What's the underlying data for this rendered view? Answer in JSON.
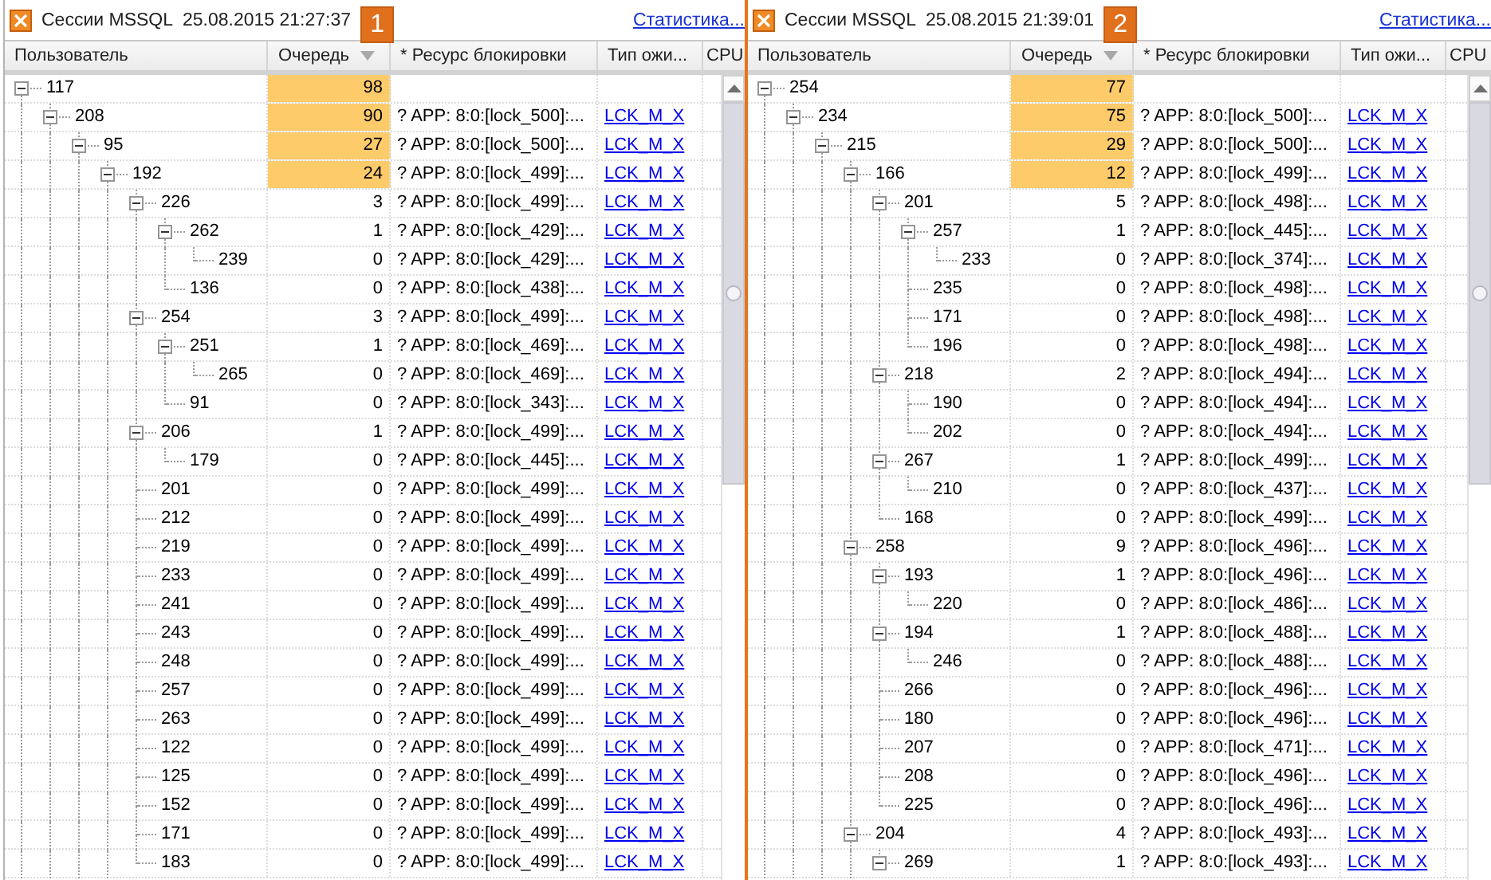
{
  "panels": [
    {
      "title": "Сессии MSSQL",
      "timestamp": "25.08.2015 21:27:37",
      "badge": "1",
      "stats_link": "Статистика...",
      "columns": [
        {
          "label": "Пользователь",
          "sorted": false
        },
        {
          "label": "Очередь",
          "sorted": true
        },
        {
          "label": "* Ресурс блокировки",
          "sorted": false
        },
        {
          "label": "Тип ожи...",
          "sorted": false
        },
        {
          "label": "CPU"
        }
      ],
      "rows": [
        {
          "user": "117",
          "queue": "98",
          "highlighted": true,
          "expanded": true,
          "children": [
            {
              "user": "208",
              "queue": "90",
              "highlighted": true,
              "resource": "? APP: 8:0:[lock_500]:...",
              "wait_type": "LCK_M_X",
              "expanded": true,
              "children": [
                {
                  "user": "95",
                  "queue": "27",
                  "highlighted": true,
                  "resource": "? APP: 8:0:[lock_500]:...",
                  "wait_type": "LCK_M_X",
                  "expanded": true,
                  "children": [
                    {
                      "user": "192",
                      "queue": "24",
                      "highlighted": true,
                      "resource": "? APP: 8:0:[lock_499]:...",
                      "wait_type": "LCK_M_X",
                      "expanded": true,
                      "children": [
                        {
                          "user": "226",
                          "queue": "3",
                          "highlighted": false,
                          "resource": "? APP: 8:0:[lock_499]:...",
                          "wait_type": "LCK_M_X",
                          "expanded": true,
                          "children": [
                            {
                              "user": "262",
                              "queue": "1",
                              "highlighted": false,
                              "resource": "? APP: 8:0:[lock_429]:...",
                              "wait_type": "LCK_M_X",
                              "expanded": true,
                              "children": [
                                {
                                  "user": "239",
                                  "queue": "0",
                                  "highlighted": false,
                                  "resource": "? APP: 8:0:[lock_429]:...",
                                  "wait_type": "LCK_M_X"
                                }
                              ]
                            },
                            {
                              "user": "136",
                              "queue": "0",
                              "highlighted": false,
                              "resource": "? APP: 8:0:[lock_438]:...",
                              "wait_type": "LCK_M_X"
                            }
                          ]
                        },
                        {
                          "user": "254",
                          "queue": "3",
                          "highlighted": false,
                          "resource": "? APP: 8:0:[lock_499]:...",
                          "wait_type": "LCK_M_X",
                          "expanded": true,
                          "children": [
                            {
                              "user": "251",
                              "queue": "1",
                              "highlighted": false,
                              "resource": "? APP: 8:0:[lock_469]:...",
                              "wait_type": "LCK_M_X",
                              "expanded": true,
                              "children": [
                                {
                                  "user": "265",
                                  "queue": "0",
                                  "highlighted": false,
                                  "resource": "? APP: 8:0:[lock_469]:...",
                                  "wait_type": "LCK_M_X"
                                }
                              ]
                            },
                            {
                              "user": "91",
                              "queue": "0",
                              "highlighted": false,
                              "resource": "? APP: 8:0:[lock_343]:...",
                              "wait_type": "LCK_M_X"
                            }
                          ]
                        },
                        {
                          "user": "206",
                          "queue": "1",
                          "highlighted": false,
                          "resource": "? APP: 8:0:[lock_499]:...",
                          "wait_type": "LCK_M_X",
                          "expanded": true,
                          "children": [
                            {
                              "user": "179",
                              "queue": "0",
                              "highlighted": false,
                              "resource": "? APP: 8:0:[lock_445]:...",
                              "wait_type": "LCK_M_X"
                            }
                          ]
                        },
                        {
                          "user": "201",
                          "queue": "0",
                          "highlighted": false,
                          "resource": "? APP: 8:0:[lock_499]:...",
                          "wait_type": "LCK_M_X"
                        },
                        {
                          "user": "212",
                          "queue": "0",
                          "highlighted": false,
                          "resource": "? APP: 8:0:[lock_499]:...",
                          "wait_type": "LCK_M_X"
                        },
                        {
                          "user": "219",
                          "queue": "0",
                          "highlighted": false,
                          "resource": "? APP: 8:0:[lock_499]:...",
                          "wait_type": "LCK_M_X"
                        },
                        {
                          "user": "233",
                          "queue": "0",
                          "highlighted": false,
                          "resource": "? APP: 8:0:[lock_499]:...",
                          "wait_type": "LCK_M_X"
                        },
                        {
                          "user": "241",
                          "queue": "0",
                          "highlighted": false,
                          "resource": "? APP: 8:0:[lock_499]:...",
                          "wait_type": "LCK_M_X"
                        },
                        {
                          "user": "243",
                          "queue": "0",
                          "highlighted": false,
                          "resource": "? APP: 8:0:[lock_499]:...",
                          "wait_type": "LCK_M_X"
                        },
                        {
                          "user": "248",
                          "queue": "0",
                          "highlighted": false,
                          "resource": "? APP: 8:0:[lock_499]:...",
                          "wait_type": "LCK_M_X"
                        },
                        {
                          "user": "257",
                          "queue": "0",
                          "highlighted": false,
                          "resource": "? APP: 8:0:[lock_499]:...",
                          "wait_type": "LCK_M_X"
                        },
                        {
                          "user": "263",
                          "queue": "0",
                          "highlighted": false,
                          "resource": "? APP: 8:0:[lock_499]:...",
                          "wait_type": "LCK_M_X"
                        },
                        {
                          "user": "122",
                          "queue": "0",
                          "highlighted": false,
                          "resource": "? APP: 8:0:[lock_499]:...",
                          "wait_type": "LCK_M_X"
                        },
                        {
                          "user": "125",
                          "queue": "0",
                          "highlighted": false,
                          "resource": "? APP: 8:0:[lock_499]:...",
                          "wait_type": "LCK_M_X"
                        },
                        {
                          "user": "152",
                          "queue": "0",
                          "highlighted": false,
                          "resource": "? APP: 8:0:[lock_499]:...",
                          "wait_type": "LCK_M_X"
                        },
                        {
                          "user": "171",
                          "queue": "0",
                          "highlighted": false,
                          "resource": "? APP: 8:0:[lock_499]:...",
                          "wait_type": "LCK_M_X"
                        },
                        {
                          "user": "183",
                          "queue": "0",
                          "highlighted": false,
                          "resource": "? APP: 8:0:[lock_499]:...",
                          "wait_type": "LCK_M_X"
                        }
                      ]
                    }
                  ]
                }
              ]
            }
          ]
        }
      ]
    },
    {
      "title": "Сессии MSSQL",
      "timestamp": "25.08.2015 21:39:01",
      "badge": "2",
      "stats_link": "Статистика...",
      "columns": [
        {
          "label": "Пользователь",
          "sorted": false
        },
        {
          "label": "Очередь",
          "sorted": true
        },
        {
          "label": "* Ресурс блокировки",
          "sorted": false
        },
        {
          "label": "Тип ожи...",
          "sorted": false
        },
        {
          "label": "CPU"
        }
      ],
      "rows": [
        {
          "user": "254",
          "queue": "77",
          "highlighted": true,
          "expanded": true,
          "children": [
            {
              "user": "234",
              "queue": "75",
              "highlighted": true,
              "resource": "? APP: 8:0:[lock_500]:...",
              "wait_type": "LCK_M_X",
              "expanded": true,
              "children": [
                {
                  "user": "215",
                  "queue": "29",
                  "highlighted": true,
                  "resource": "? APP: 8:0:[lock_500]:...",
                  "wait_type": "LCK_M_X",
                  "expanded": true,
                  "children": [
                    {
                      "user": "166",
                      "queue": "12",
                      "highlighted": true,
                      "resource": "? APP: 8:0:[lock_499]:...",
                      "wait_type": "LCK_M_X",
                      "expanded": true,
                      "children": [
                        {
                          "user": "201",
                          "queue": "5",
                          "highlighted": false,
                          "resource": "? APP: 8:0:[lock_498]:...",
                          "wait_type": "LCK_M_X",
                          "expanded": true,
                          "children": [
                            {
                              "user": "257",
                              "queue": "1",
                              "highlighted": false,
                              "resource": "? APP: 8:0:[lock_445]:...",
                              "wait_type": "LCK_M_X",
                              "expanded": true,
                              "children": [
                                {
                                  "user": "233",
                                  "queue": "0",
                                  "highlighted": false,
                                  "resource": "? APP: 8:0:[lock_374]:...",
                                  "wait_type": "LCK_M_X"
                                }
                              ]
                            },
                            {
                              "user": "235",
                              "queue": "0",
                              "highlighted": false,
                              "resource": "? APP: 8:0:[lock_498]:...",
                              "wait_type": "LCK_M_X"
                            },
                            {
                              "user": "171",
                              "queue": "0",
                              "highlighted": false,
                              "resource": "? APP: 8:0:[lock_498]:...",
                              "wait_type": "LCK_M_X"
                            },
                            {
                              "user": "196",
                              "queue": "0",
                              "highlighted": false,
                              "resource": "? APP: 8:0:[lock_498]:...",
                              "wait_type": "LCK_M_X"
                            }
                          ]
                        },
                        {
                          "user": "218",
                          "queue": "2",
                          "highlighted": false,
                          "resource": "? APP: 8:0:[lock_494]:...",
                          "wait_type": "LCK_M_X",
                          "expanded": true,
                          "children": [
                            {
                              "user": "190",
                              "queue": "0",
                              "highlighted": false,
                              "resource": "? APP: 8:0:[lock_494]:...",
                              "wait_type": "LCK_M_X"
                            },
                            {
                              "user": "202",
                              "queue": "0",
                              "highlighted": false,
                              "resource": "? APP: 8:0:[lock_494]:...",
                              "wait_type": "LCK_M_X"
                            }
                          ]
                        },
                        {
                          "user": "267",
                          "queue": "1",
                          "highlighted": false,
                          "resource": "? APP: 8:0:[lock_499]:...",
                          "wait_type": "LCK_M_X",
                          "expanded": true,
                          "children": [
                            {
                              "user": "210",
                              "queue": "0",
                              "highlighted": false,
                              "resource": "? APP: 8:0:[lock_437]:...",
                              "wait_type": "LCK_M_X"
                            }
                          ]
                        },
                        {
                          "user": "168",
                          "queue": "0",
                          "highlighted": false,
                          "resource": "? APP: 8:0:[lock_499]:...",
                          "wait_type": "LCK_M_X"
                        }
                      ]
                    },
                    {
                      "user": "258",
                      "queue": "9",
                      "highlighted": false,
                      "resource": "? APP: 8:0:[lock_496]:...",
                      "wait_type": "LCK_M_X",
                      "expanded": true,
                      "children": [
                        {
                          "user": "193",
                          "queue": "1",
                          "highlighted": false,
                          "resource": "? APP: 8:0:[lock_496]:...",
                          "wait_type": "LCK_M_X",
                          "expanded": true,
                          "children": [
                            {
                              "user": "220",
                              "queue": "0",
                              "highlighted": false,
                              "resource": "? APP: 8:0:[lock_486]:...",
                              "wait_type": "LCK_M_X"
                            }
                          ]
                        },
                        {
                          "user": "194",
                          "queue": "1",
                          "highlighted": false,
                          "resource": "? APP: 8:0:[lock_488]:...",
                          "wait_type": "LCK_M_X",
                          "expanded": true,
                          "children": [
                            {
                              "user": "246",
                              "queue": "0",
                              "highlighted": false,
                              "resource": "? APP: 8:0:[lock_488]:...",
                              "wait_type": "LCK_M_X"
                            }
                          ]
                        },
                        {
                          "user": "266",
                          "queue": "0",
                          "highlighted": false,
                          "resource": "? APP: 8:0:[lock_496]:...",
                          "wait_type": "LCK_M_X"
                        },
                        {
                          "user": "180",
                          "queue": "0",
                          "highlighted": false,
                          "resource": "? APP: 8:0:[lock_496]:...",
                          "wait_type": "LCK_M_X"
                        },
                        {
                          "user": "207",
                          "queue": "0",
                          "highlighted": false,
                          "resource": "? APP: 8:0:[lock_471]:...",
                          "wait_type": "LCK_M_X"
                        },
                        {
                          "user": "208",
                          "queue": "0",
                          "highlighted": false,
                          "resource": "? APP: 8:0:[lock_496]:...",
                          "wait_type": "LCK_M_X"
                        },
                        {
                          "user": "225",
                          "queue": "0",
                          "highlighted": false,
                          "resource": "? APP: 8:0:[lock_496]:...",
                          "wait_type": "LCK_M_X"
                        }
                      ]
                    },
                    {
                      "user": "204",
                      "queue": "4",
                      "highlighted": false,
                      "resource": "? APP: 8:0:[lock_493]:...",
                      "wait_type": "LCK_M_X",
                      "expanded": true,
                      "children": [
                        {
                          "user": "269",
                          "queue": "1",
                          "highlighted": false,
                          "resource": "? APP: 8:0:[lock_493]:...",
                          "wait_type": "LCK_M_X",
                          "expanded": true
                        }
                      ]
                    }
                  ]
                }
              ]
            }
          ]
        }
      ]
    }
  ]
}
